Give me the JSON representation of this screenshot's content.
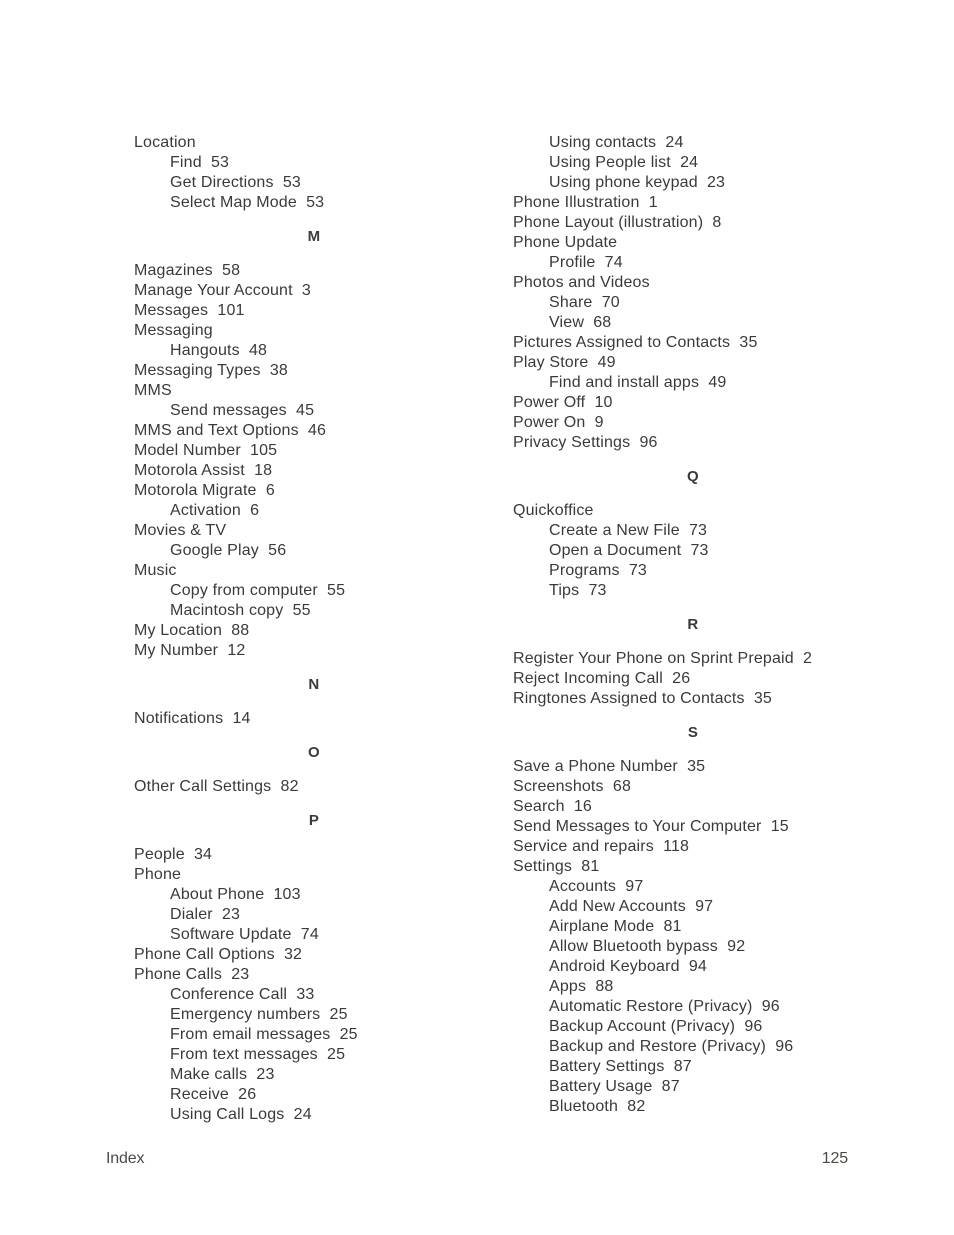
{
  "document": {
    "type": "index",
    "footer_label": "Index",
    "page_number": "125",
    "text_color": "#3a3a38"
  },
  "left_column": [
    {
      "kind": "entry",
      "level": 1,
      "text": "Location"
    },
    {
      "kind": "entry",
      "level": 2,
      "text": "Find  53"
    },
    {
      "kind": "entry",
      "level": 2,
      "text": "Get Directions  53"
    },
    {
      "kind": "entry",
      "level": 2,
      "text": "Select Map Mode  53"
    },
    {
      "kind": "letter",
      "text": "M"
    },
    {
      "kind": "entry",
      "level": 1,
      "text": "Magazines  58"
    },
    {
      "kind": "entry",
      "level": 1,
      "text": "Manage Your Account  3"
    },
    {
      "kind": "entry",
      "level": 1,
      "text": "Messages  101"
    },
    {
      "kind": "entry",
      "level": 1,
      "text": "Messaging"
    },
    {
      "kind": "entry",
      "level": 2,
      "text": "Hangouts  48"
    },
    {
      "kind": "entry",
      "level": 1,
      "text": "Messaging Types  38"
    },
    {
      "kind": "entry",
      "level": 1,
      "text": "MMS"
    },
    {
      "kind": "entry",
      "level": 2,
      "text": "Send messages  45"
    },
    {
      "kind": "entry",
      "level": 1,
      "text": "MMS and Text Options  46"
    },
    {
      "kind": "entry",
      "level": 1,
      "text": "Model Number  105"
    },
    {
      "kind": "entry",
      "level": 1,
      "text": "Motorola Assist  18"
    },
    {
      "kind": "entry",
      "level": 1,
      "text": "Motorola Migrate  6"
    },
    {
      "kind": "entry",
      "level": 2,
      "text": "Activation  6"
    },
    {
      "kind": "entry",
      "level": 1,
      "text": "Movies & TV"
    },
    {
      "kind": "entry",
      "level": 2,
      "text": "Google Play  56"
    },
    {
      "kind": "entry",
      "level": 1,
      "text": "Music"
    },
    {
      "kind": "entry",
      "level": 2,
      "text": "Copy from computer  55"
    },
    {
      "kind": "entry",
      "level": 2,
      "text": "Macintosh copy  55"
    },
    {
      "kind": "entry",
      "level": 1,
      "text": "My Location  88"
    },
    {
      "kind": "entry",
      "level": 1,
      "text": "My Number  12"
    },
    {
      "kind": "letter",
      "text": "N"
    },
    {
      "kind": "entry",
      "level": 1,
      "text": "Notifications  14"
    },
    {
      "kind": "letter",
      "text": "O"
    },
    {
      "kind": "entry",
      "level": 1,
      "text": "Other Call Settings  82"
    },
    {
      "kind": "letter",
      "text": "P"
    },
    {
      "kind": "entry",
      "level": 1,
      "text": "People  34"
    },
    {
      "kind": "entry",
      "level": 1,
      "text": "Phone"
    },
    {
      "kind": "entry",
      "level": 2,
      "text": "About Phone  103"
    },
    {
      "kind": "entry",
      "level": 2,
      "text": "Dialer  23"
    },
    {
      "kind": "entry",
      "level": 2,
      "text": "Software Update  74"
    },
    {
      "kind": "entry",
      "level": 1,
      "text": "Phone Call Options  32"
    },
    {
      "kind": "entry",
      "level": 1,
      "text": "Phone Calls  23"
    },
    {
      "kind": "entry",
      "level": 2,
      "text": "Conference Call  33"
    },
    {
      "kind": "entry",
      "level": 2,
      "text": "Emergency numbers  25"
    },
    {
      "kind": "entry",
      "level": 2,
      "text": "From email messages  25"
    },
    {
      "kind": "entry",
      "level": 2,
      "text": "From text messages  25"
    },
    {
      "kind": "entry",
      "level": 2,
      "text": "Make calls  23"
    },
    {
      "kind": "entry",
      "level": 2,
      "text": "Receive  26"
    },
    {
      "kind": "entry",
      "level": 2,
      "text": "Using Call Logs  24"
    }
  ],
  "right_column": [
    {
      "kind": "entry",
      "level": 2,
      "text": "Using contacts  24"
    },
    {
      "kind": "entry",
      "level": 2,
      "text": "Using People list  24"
    },
    {
      "kind": "entry",
      "level": 2,
      "text": "Using phone keypad  23"
    },
    {
      "kind": "entry",
      "level": 1,
      "text": "Phone Illustration  1"
    },
    {
      "kind": "entry",
      "level": 1,
      "text": "Phone Layout (illustration)  8"
    },
    {
      "kind": "entry",
      "level": 1,
      "text": "Phone Update"
    },
    {
      "kind": "entry",
      "level": 2,
      "text": "Profile  74"
    },
    {
      "kind": "entry",
      "level": 1,
      "text": "Photos and Videos"
    },
    {
      "kind": "entry",
      "level": 2,
      "text": "Share  70"
    },
    {
      "kind": "entry",
      "level": 2,
      "text": "View  68"
    },
    {
      "kind": "entry",
      "level": 1,
      "text": "Pictures Assigned to Contacts  35"
    },
    {
      "kind": "entry",
      "level": 1,
      "text": "Play Store  49"
    },
    {
      "kind": "entry",
      "level": 2,
      "text": "Find and install apps  49"
    },
    {
      "kind": "entry",
      "level": 1,
      "text": "Power Off  10"
    },
    {
      "kind": "entry",
      "level": 1,
      "text": "Power On  9"
    },
    {
      "kind": "entry",
      "level": 1,
      "text": "Privacy Settings  96"
    },
    {
      "kind": "letter",
      "text": "Q"
    },
    {
      "kind": "entry",
      "level": 1,
      "text": "Quickoffice"
    },
    {
      "kind": "entry",
      "level": 2,
      "text": "Create a New File  73"
    },
    {
      "kind": "entry",
      "level": 2,
      "text": "Open a Document  73"
    },
    {
      "kind": "entry",
      "level": 2,
      "text": "Programs  73"
    },
    {
      "kind": "entry",
      "level": 2,
      "text": "Tips  73"
    },
    {
      "kind": "letter",
      "text": "R"
    },
    {
      "kind": "entry",
      "level": 1,
      "text": "Register Your Phone on Sprint Prepaid  2"
    },
    {
      "kind": "entry",
      "level": 1,
      "text": "Reject Incoming Call  26"
    },
    {
      "kind": "entry",
      "level": 1,
      "text": "Ringtones Assigned to Contacts  35"
    },
    {
      "kind": "letter",
      "text": "S"
    },
    {
      "kind": "entry",
      "level": 1,
      "text": "Save a Phone Number  35"
    },
    {
      "kind": "entry",
      "level": 1,
      "text": "Screenshots  68"
    },
    {
      "kind": "entry",
      "level": 1,
      "text": "Search  16"
    },
    {
      "kind": "entry",
      "level": 1,
      "text": "Send Messages to Your Computer  15"
    },
    {
      "kind": "entry",
      "level": 1,
      "text": "Service and repairs  118"
    },
    {
      "kind": "entry",
      "level": 1,
      "text": "Settings  81"
    },
    {
      "kind": "entry",
      "level": 2,
      "text": "Accounts  97"
    },
    {
      "kind": "entry",
      "level": 2,
      "text": "Add New Accounts  97"
    },
    {
      "kind": "entry",
      "level": 2,
      "text": "Airplane Mode  81"
    },
    {
      "kind": "entry",
      "level": 2,
      "text": "Allow Bluetooth bypass  92"
    },
    {
      "kind": "entry",
      "level": 2,
      "text": "Android Keyboard  94"
    },
    {
      "kind": "entry",
      "level": 2,
      "text": "Apps  88"
    },
    {
      "kind": "entry",
      "level": 2,
      "text": "Automatic Restore (Privacy)  96"
    },
    {
      "kind": "entry",
      "level": 2,
      "text": "Backup Account (Privacy)  96"
    },
    {
      "kind": "entry",
      "level": 2,
      "text": "Backup and Restore (Privacy)  96"
    },
    {
      "kind": "entry",
      "level": 2,
      "text": "Battery Settings  87"
    },
    {
      "kind": "entry",
      "level": 2,
      "text": "Battery Usage  87"
    },
    {
      "kind": "entry",
      "level": 2,
      "text": "Bluetooth  82"
    }
  ]
}
